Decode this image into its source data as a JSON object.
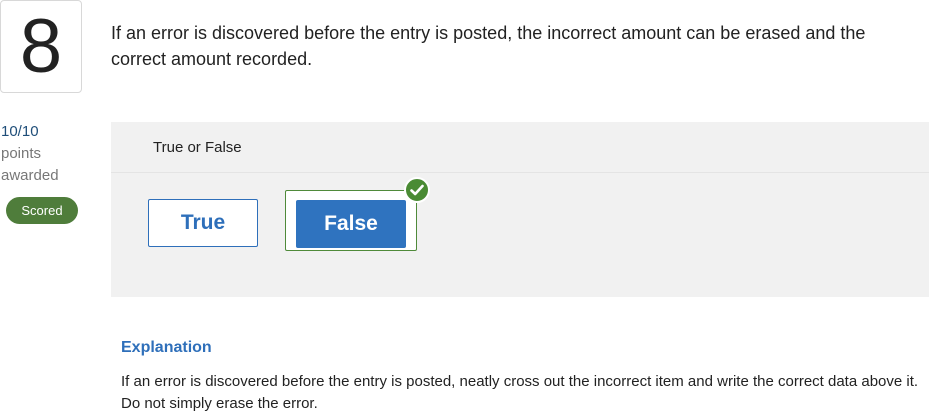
{
  "question": {
    "number": "8",
    "text": "If an error is discovered before the entry is posted, the incorrect amount can be erased and the correct amount recorded."
  },
  "score": {
    "value": "10/10",
    "line1": "points",
    "line2": "awarded",
    "status": "Scored",
    "status_color": "#4f7d3b"
  },
  "answer": {
    "prompt": "True or False",
    "options": [
      {
        "label": "True",
        "selected": false
      },
      {
        "label": "False",
        "selected": true,
        "correct": true
      }
    ],
    "correct_icon": "check-circle-icon"
  },
  "explanation": {
    "title": "Explanation",
    "text": "If an error is discovered before the entry is posted, neatly cross out the incorrect item and write the correct data above it. Do not simply erase the error."
  },
  "colors": {
    "accent": "#2e6fba",
    "correct": "#4a8b34"
  }
}
